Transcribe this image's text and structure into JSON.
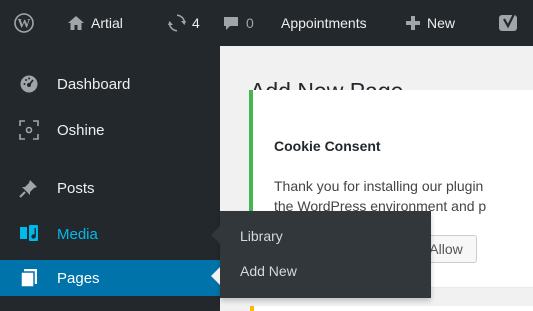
{
  "adminbar": {
    "site_name": "Artial",
    "updates_count": "4",
    "comments_count": "0",
    "appointments_label": "Appointments",
    "new_label": "New"
  },
  "sidebar": {
    "items": [
      {
        "label": "Dashboard",
        "icon": "dashboard-icon"
      },
      {
        "label": "Oshine",
        "icon": "oshine-icon"
      },
      {
        "label": "Posts",
        "icon": "pin-icon"
      },
      {
        "label": "Media",
        "icon": "media-icon"
      },
      {
        "label": "Pages",
        "icon": "pages-icon"
      }
    ]
  },
  "flyout": {
    "items": [
      "Library",
      "Add New"
    ]
  },
  "main": {
    "page_title": "Add New Page",
    "notice": {
      "title": "Cookie Consent",
      "line1": "Thank you for installing our plugin",
      "line2": "the WordPress environment and p",
      "button_label": "Allow"
    }
  },
  "colors": {
    "adminbar_bg": "#23282d",
    "sidebar_bg": "#23282d",
    "current_item_bg": "#0073aa",
    "hover_text": "#00b9eb",
    "notice_border": "#46b450",
    "warning_accent": "#ffb900"
  }
}
